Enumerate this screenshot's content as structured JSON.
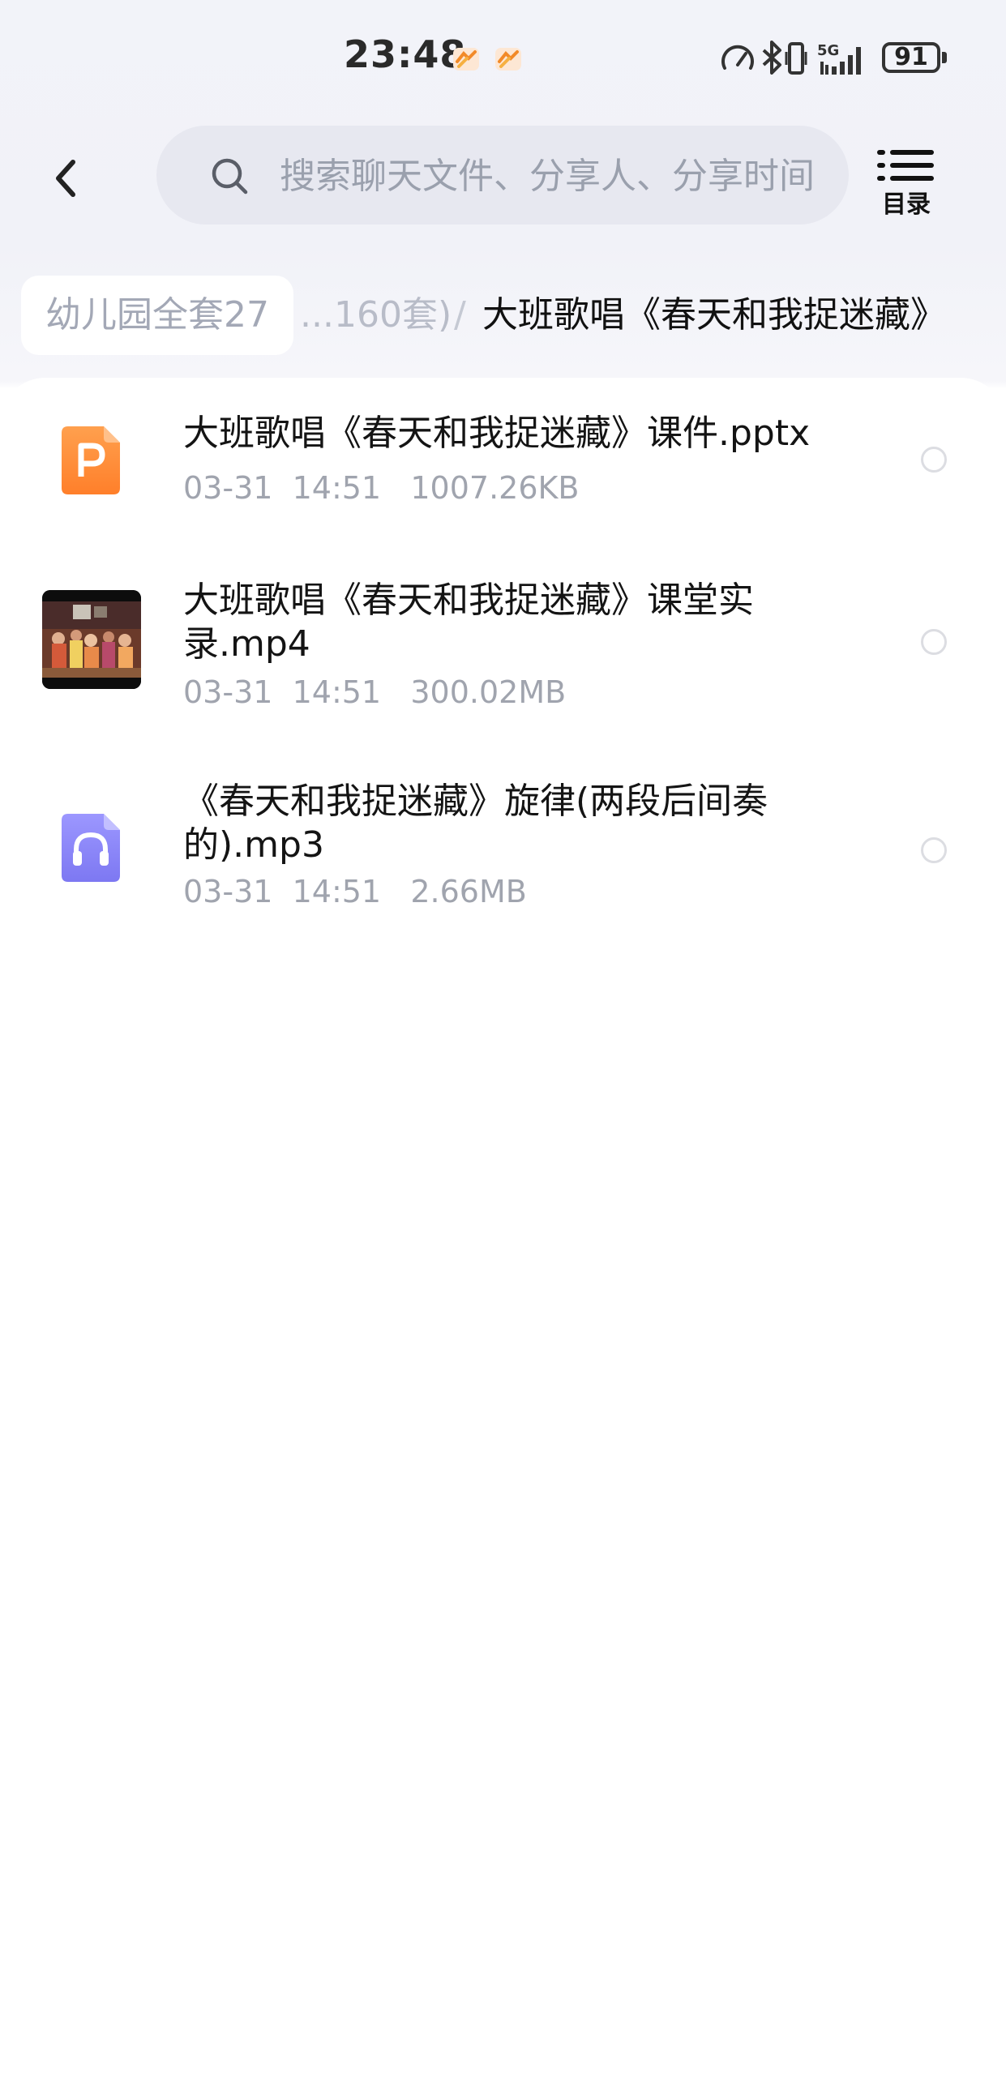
{
  "status_bar": {
    "time": "23:48",
    "battery": "91",
    "network": "5G",
    "icons": [
      "orange-app-notification-icon",
      "orange-app-notification-icon",
      "data-speed-icon",
      "bluetooth-icon",
      "vibrate-icon",
      "5g-signal-icon",
      "battery-icon"
    ]
  },
  "header": {
    "back_icon": "chevron-left-icon",
    "search_placeholder": "搜索聊天文件、分享人、分享时间",
    "toc_label": "目录"
  },
  "breadcrumb": {
    "root": "幼儿园全套27",
    "middle": "...160套)",
    "separator": "/",
    "current": "大班歌唱《春天和我捉迷藏》"
  },
  "files": [
    {
      "name": "大班歌唱《春天和我捉迷藏》课件.pptx",
      "date": "03-31",
      "time": "14:51",
      "size": "1007.26KB",
      "icon": "pptx-file-icon",
      "icon_color": "#ff8c3a"
    },
    {
      "name": "大班歌唱《春天和我捉迷藏》课堂实录.mp4",
      "date": "03-31",
      "time": "14:51",
      "size": "300.02MB",
      "icon": "video-thumbnail"
    },
    {
      "name": "《春天和我捉迷藏》旋律(两段后间奏的).mp3",
      "date": "03-31",
      "time": "14:51",
      "size": "2.66MB",
      "icon": "audio-file-icon",
      "icon_color": "#8b86f5"
    }
  ]
}
